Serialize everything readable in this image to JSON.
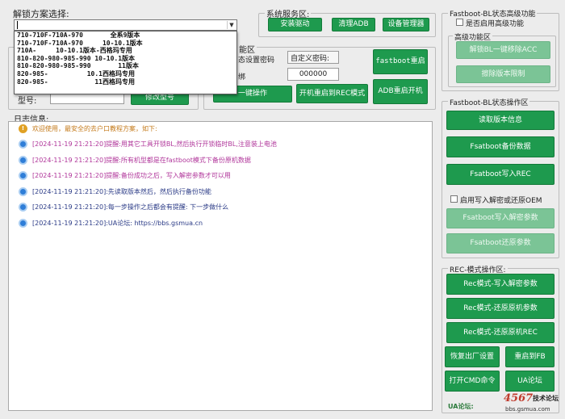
{
  "unlock": {
    "title": "解锁方案选择:",
    "selected_value": "",
    "options": [
      "710-710F-710A-970       全系9版本",
      "710-710F-710A-970     10-10.1版本",
      "710A-     10-10.1版本-西格玛专用",
      "810-820-980-985-990 10-10.1版本",
      "810-820-980-985-990       11版本",
      "820-985-          10.1西格玛专用",
      "820-985-            11西格玛专用"
    ]
  },
  "left_partial": {
    "model_label": "型号:",
    "model_value": "",
    "modify_model": "修改型号"
  },
  "system_service": {
    "title": "系统服务区:",
    "install_driver": "安装驱动",
    "clean_adb": "清理ADB",
    "device_manager": "设备管理器"
  },
  "mid_area": {
    "title_fragment": "能区",
    "status_set_password_label": "态设置密码",
    "custom_password_label": "自定义密码:",
    "bind_label": "绑",
    "password_value": "000000",
    "fastboot_reboot": "fastboot重启",
    "one_click": "一键操作",
    "boot_to_rec": "开机重启到REC模式",
    "adb_reboot": "ADB重启开机"
  },
  "log": {
    "title": "日志信息:",
    "lines": [
      {
        "icon": "warning-icon",
        "text": "欢迎使用，最安全的去户口教程方案，如下:",
        "color": "#c47a1a"
      },
      {
        "icon": "info-icon",
        "text": "[2024-11-19 21:21:20]提醒:用其它工具开锁BL,然后执行开锁临时BL,注意装上电池",
        "color": "#b0359a"
      },
      {
        "icon": "info-icon",
        "text": "[2024-11-19 21:21:20]提醒:所有机型都是在fastboot模式下备份原机数据",
        "color": "#b0359a"
      },
      {
        "icon": "info-icon",
        "text": "[2024-11-19 21:21:20]提醒:备份成功之后，写入解密参数才可以用",
        "color": "#b0359a"
      },
      {
        "icon": "info-icon",
        "text": "[2024-11-19 21:21:20]:先读取版本然后，然后执行备份功能",
        "color": "#2a3a86"
      },
      {
        "icon": "info-icon",
        "text": "[2024-11-19 21:21:20]:每一步操作之后都会有提醒: 下一步做什么",
        "color": "#2a3a86"
      },
      {
        "icon": "info-icon",
        "text": "[2024-11-19 21:21:20]:UA论坛: https://bbs.gsmua.cn",
        "color": "#2a3a86"
      }
    ]
  },
  "fastboot_bl_status": {
    "title": "Fastboot-BL状态高级功能",
    "enable_advanced": "是否启用高级功能",
    "advanced_title": "高级功能区",
    "unlock_bl_remove_acc": "解锁BL一键移除ACC",
    "erase_version_limit": "擦除版本限制"
  },
  "fastboot_ops": {
    "title": "Fastboot-BL状态操作区",
    "read_version": "读取版本信息",
    "backup_data": "Fsatboot备份数据",
    "write_rec": "Fsatboot写入REC",
    "enable_write_label": "启用写入解密或还原OEM",
    "write_decrypt_params": "Fsatboot写入解密参数",
    "restore_params": "Fsatboot还原参数"
  },
  "rec_ops": {
    "title": "REC-模式操作区:",
    "write_decrypt": "Rec模式-写入解密参数",
    "restore_original_params": "Rec模式-还原原机参数",
    "restore_original_rec": "Rec模式-还原原机REC",
    "factory_reset": "恢复出厂设置",
    "reboot_fb": "重启到FB",
    "open_cmd": "打开CMD命令",
    "ua_forum": "UA论坛"
  },
  "footer": {
    "ua_label": "UA论坛:",
    "watermark_number": "4567",
    "watermark_cn": "技术论坛",
    "watermark_url": "bbs.gsmua.com"
  },
  "colors": {
    "button_green": "#1e9a4e",
    "button_disabled": "#7bc496",
    "window_bg": "#ececec"
  }
}
